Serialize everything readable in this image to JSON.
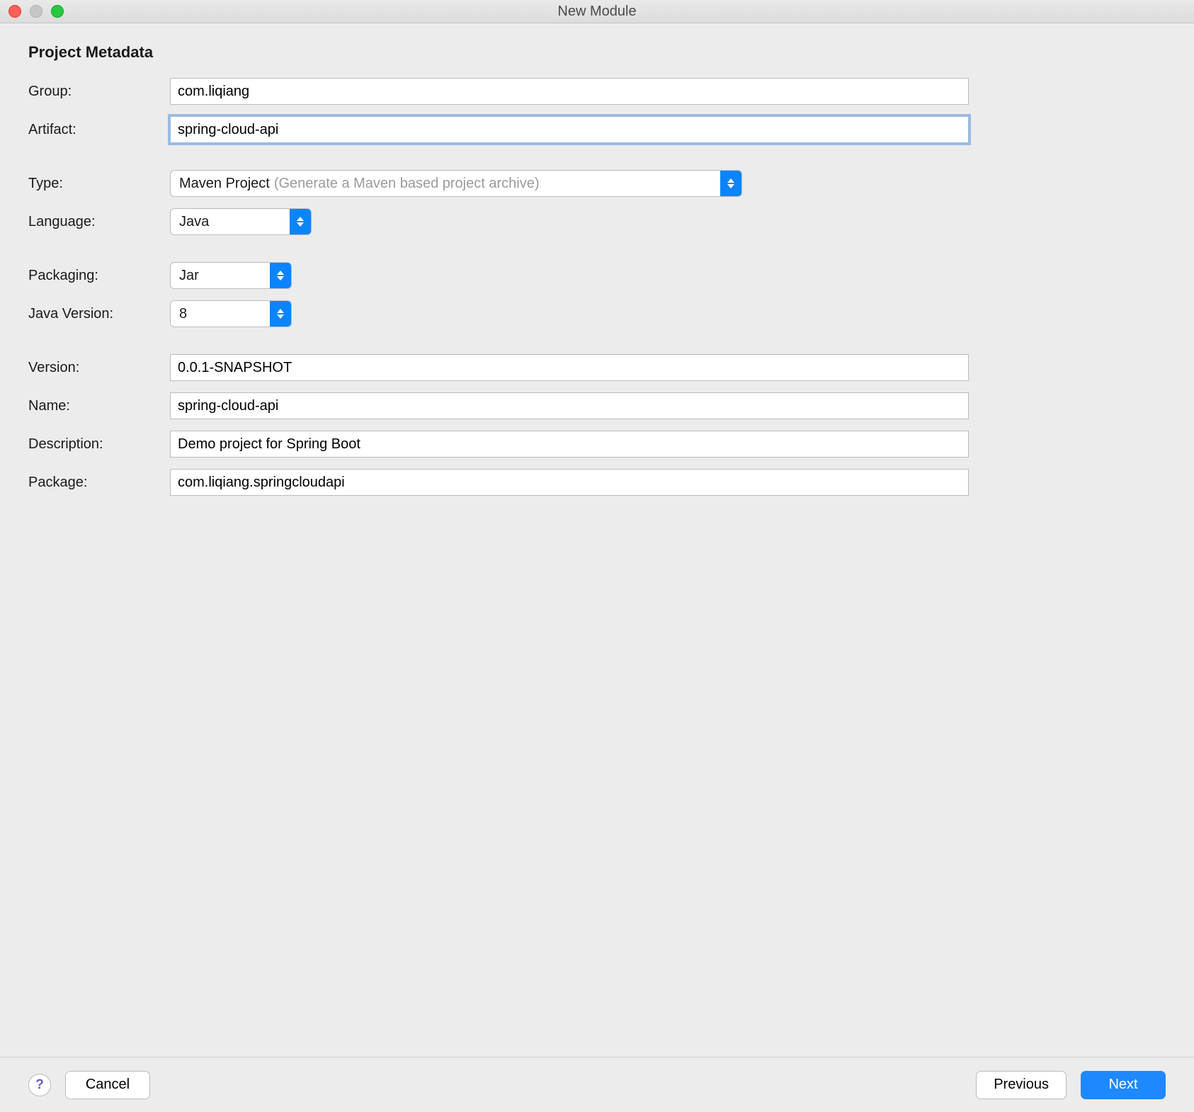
{
  "window": {
    "title": "New Module"
  },
  "heading": "Project Metadata",
  "labels": {
    "group": "Group:",
    "artifact": "Artifact:",
    "type": "Type:",
    "language": "Language:",
    "packaging": "Packaging:",
    "javaVersion": "Java Version:",
    "version": "Version:",
    "name": "Name:",
    "description": "Description:",
    "package": "Package:"
  },
  "fields": {
    "group": "com.liqiang",
    "artifact": "spring-cloud-api",
    "type": {
      "value": "Maven Project",
      "hint": "(Generate a Maven based project archive)"
    },
    "language": "Java",
    "packaging": "Jar",
    "javaVersion": "8",
    "version": "0.0.1-SNAPSHOT",
    "name": "spring-cloud-api",
    "description": "Demo project for Spring Boot",
    "package": "com.liqiang.springcloudapi"
  },
  "footer": {
    "help": "?",
    "cancel": "Cancel",
    "previous": "Previous",
    "next": "Next"
  }
}
